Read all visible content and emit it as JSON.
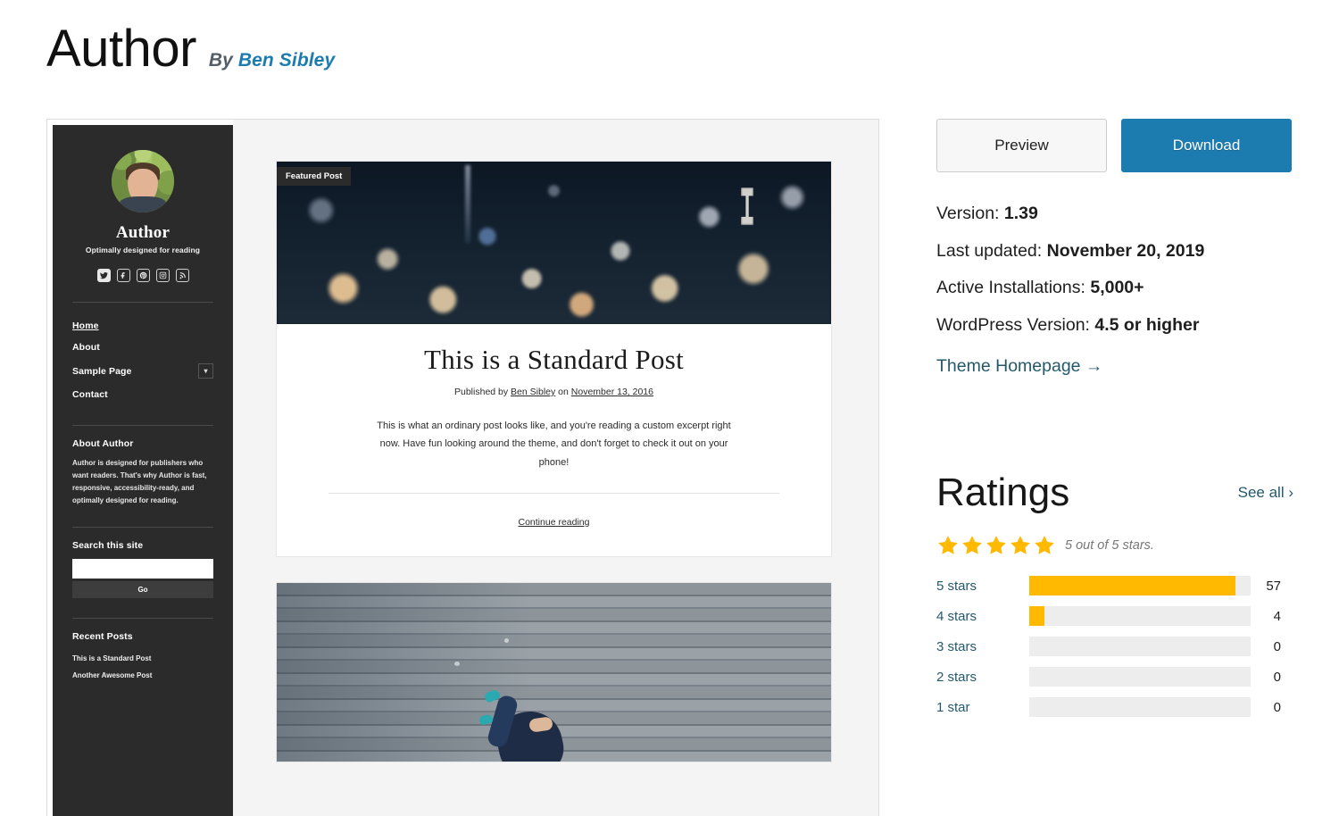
{
  "header": {
    "theme_title": "Author",
    "by_label": "By",
    "author_name": "Ben Sibley"
  },
  "actions": {
    "preview_label": "Preview",
    "download_label": "Download"
  },
  "meta": [
    {
      "label": "Version:",
      "value": "1.39"
    },
    {
      "label": "Last updated:",
      "value": "November 20, 2019"
    },
    {
      "label": "Active Installations:",
      "value": "5,000+"
    },
    {
      "label": "WordPress Version:",
      "value": "4.5 or higher"
    }
  ],
  "theme_homepage_link": "Theme Homepage  →",
  "ratings": {
    "title": "Ratings",
    "see_all_label": "See all  ›",
    "star_count": 5,
    "summary": "5 out of 5 stars.",
    "star_color": "#ffb900",
    "rows": [
      {
        "label": "5 stars",
        "count": "57",
        "percent": 93
      },
      {
        "label": "4 stars",
        "count": "4",
        "percent": 7
      },
      {
        "label": "3 stars",
        "count": "0",
        "percent": 0
      },
      {
        "label": "2 stars",
        "count": "0",
        "percent": 0
      },
      {
        "label": "1 star",
        "count": "0",
        "percent": 0
      }
    ]
  },
  "preview": {
    "sidebar": {
      "site_name": "Author",
      "tagline": "Optimally designed for reading",
      "social": [
        {
          "name": "twitter-icon"
        },
        {
          "name": "facebook-icon"
        },
        {
          "name": "pinterest-icon"
        },
        {
          "name": "instagram-icon"
        },
        {
          "name": "rss-icon"
        }
      ],
      "menu": [
        {
          "label": "Home",
          "active": true,
          "has_submenu": false
        },
        {
          "label": "About",
          "active": false,
          "has_submenu": false
        },
        {
          "label": "Sample Page",
          "active": false,
          "has_submenu": true
        },
        {
          "label": "Contact",
          "active": false,
          "has_submenu": false
        }
      ],
      "about_widget": {
        "title": "About Author",
        "text": "Author is designed for publishers who want readers. That's why Author is fast, responsive, accessibility-ready, and optimally designed for reading."
      },
      "search_widget": {
        "title": "Search this site",
        "value": "",
        "placeholder": "",
        "button_label": "Go"
      },
      "recent_widget": {
        "title": "Recent Posts",
        "items": [
          "This is a Standard Post",
          "Another Awesome Post"
        ]
      }
    },
    "posts": [
      {
        "badge": "Featured Post",
        "title": "This is a Standard Post",
        "meta_prefix": "Published by ",
        "meta_author": "Ben Sibley",
        "meta_middle": " on ",
        "meta_date": "November 13, 2016",
        "excerpt": "This is what an ordinary post looks like, and you're reading a custom excerpt right now. Have fun looking around the theme, and don't forget to check it out on your phone!",
        "continue_label": "Continue reading"
      }
    ]
  }
}
